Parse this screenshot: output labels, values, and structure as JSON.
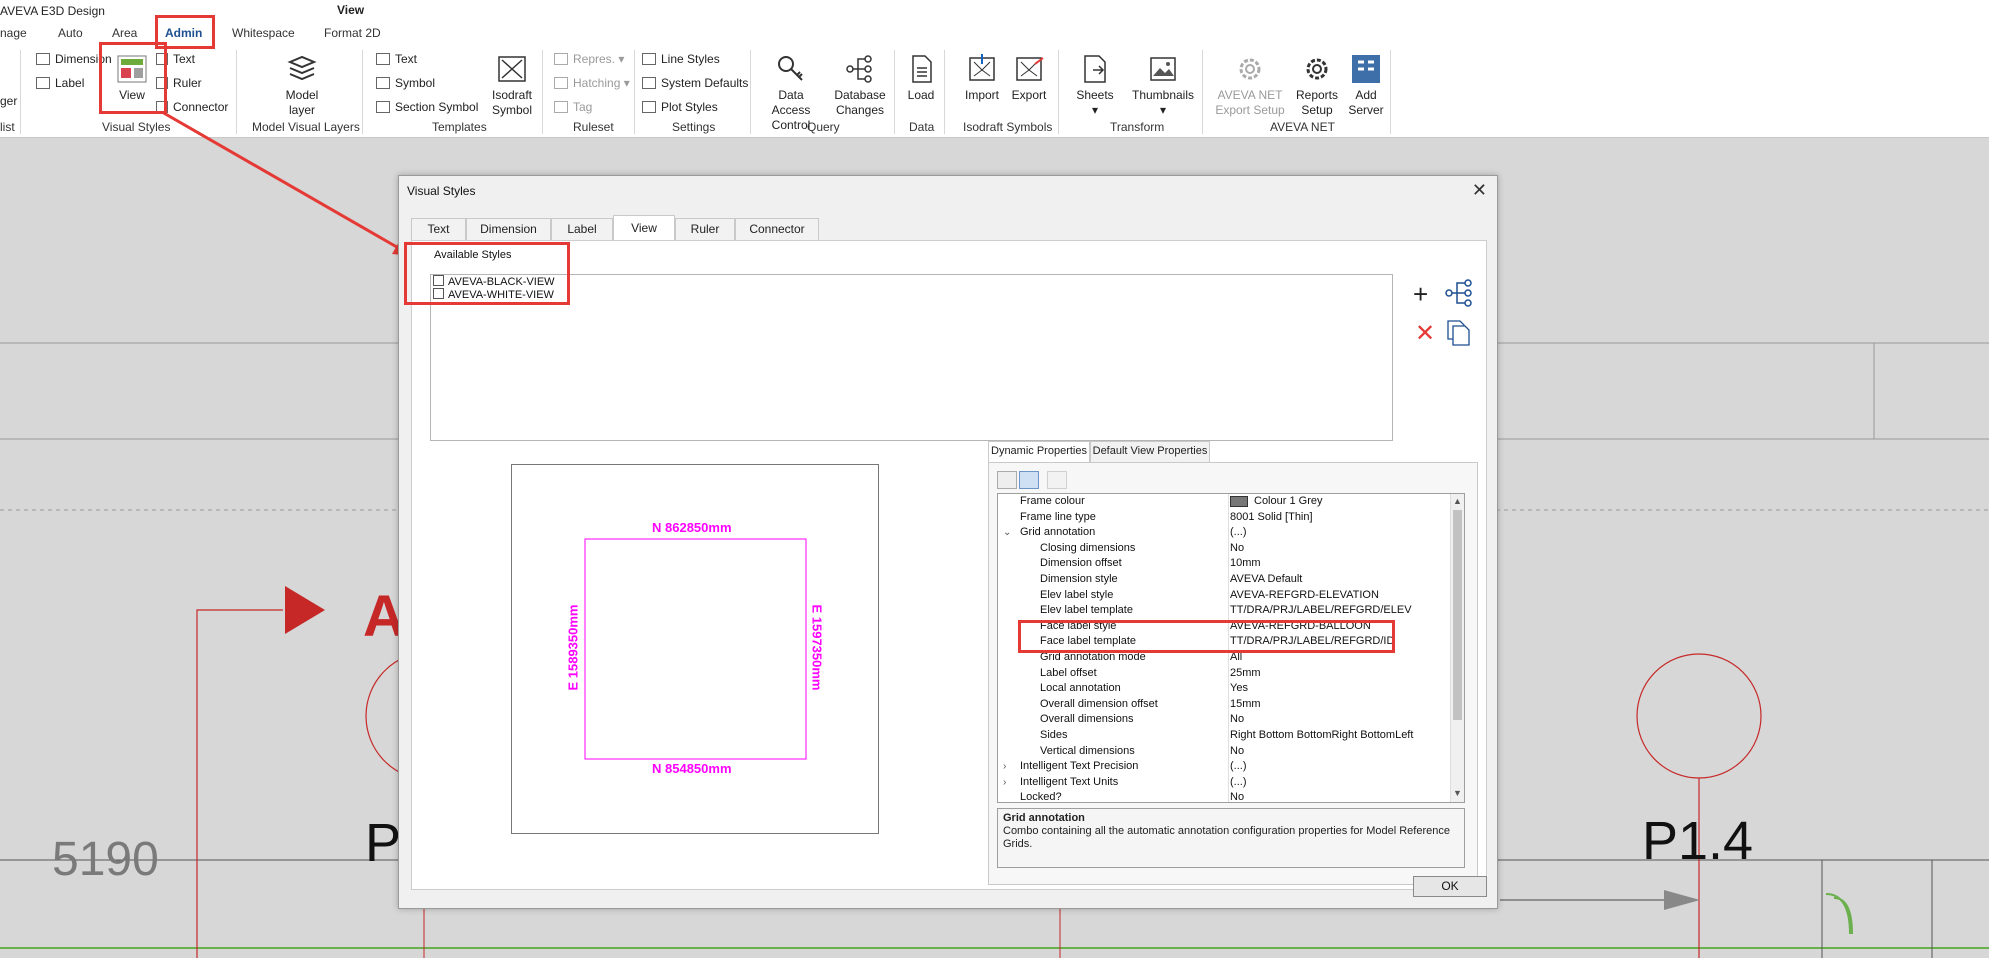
{
  "app": {
    "title": "AVEVA E3D Design",
    "document_title": "View"
  },
  "menu": {
    "tabs": [
      "nage",
      "Auto",
      "Area",
      "Admin",
      "Whitespace",
      "Format 2D"
    ],
    "active": "Admin"
  },
  "ribbon": {
    "groups": [
      {
        "label": "list",
        "items": [
          "ger"
        ]
      },
      {
        "label": "Visual Styles",
        "items": [
          "Dimension",
          "Label",
          "View",
          "Text",
          "Ruler",
          "Connector"
        ]
      },
      {
        "label": "Model Visual Layers",
        "items": [
          "Model",
          "layer"
        ]
      },
      {
        "label": "Templates",
        "items": [
          "Text",
          "Symbol",
          "Section Symbol",
          "Isodraft",
          "Symbol"
        ]
      },
      {
        "label": "Ruleset",
        "items": [
          "Repres.",
          "Hatching",
          "Tag"
        ]
      },
      {
        "label": "Settings",
        "items": [
          "Line Styles",
          "System Defaults",
          "Plot Styles"
        ]
      },
      {
        "label": "Query",
        "items": [
          "Data Access",
          "Control",
          "Database",
          "Changes"
        ]
      },
      {
        "label": "Data",
        "items": [
          "Load"
        ]
      },
      {
        "label": "Isodraft Symbols",
        "items": [
          "Import",
          "Export"
        ]
      },
      {
        "label": "Transform",
        "items": [
          "Sheets",
          "Thumbnails"
        ]
      },
      {
        "label": "AVEVA NET",
        "items": [
          "AVEVA NET",
          "Export Setup",
          "Reports",
          "Setup",
          "Add",
          "Server"
        ]
      }
    ]
  },
  "background": {
    "labels": [
      "5190",
      "P1.4",
      "A",
      "P"
    ]
  },
  "dialog": {
    "title": "Visual Styles",
    "tabs": [
      "Text",
      "Dimension",
      "Label",
      "View",
      "Ruler",
      "Connector"
    ],
    "active_tab": "View",
    "available_styles_label": "Available Styles",
    "styles": [
      "AVEVA-BLACK-VIEW",
      "AVEVA-WHITE-VIEW"
    ],
    "preview": {
      "top": "N 862850mm",
      "bottom": "N 854850mm",
      "left": "E 1589350mm",
      "right": "E 1597350mm"
    },
    "property_tabs": [
      "Dynamic Properties",
      "Default View Properties"
    ],
    "properties": [
      {
        "name": "Frame colour",
        "value": "Colour 1 Grey",
        "indent": 0
      },
      {
        "name": "Frame line type",
        "value": "8001 Solid [Thin]",
        "indent": 0
      },
      {
        "name": "Grid annotation",
        "value": "(...)",
        "indent": 0,
        "expander": "expanded"
      },
      {
        "name": "Closing dimensions",
        "value": "No",
        "indent": 1
      },
      {
        "name": "Dimension offset",
        "value": "10mm",
        "indent": 1
      },
      {
        "name": "Dimension style",
        "value": "AVEVA Default",
        "indent": 1
      },
      {
        "name": "Elev label style",
        "value": "AVEVA-REFGRD-ELEVATION",
        "indent": 1
      },
      {
        "name": "Elev label template",
        "value": "TT/DRA/PRJ/LABEL/REFGRD/ELEV",
        "indent": 1
      },
      {
        "name": "Face label style",
        "value": "AVEVA-REFGRD-BALLOON",
        "indent": 1
      },
      {
        "name": "Face label template",
        "value": "TT/DRA/PRJ/LABEL/REFGRD/ID",
        "indent": 1
      },
      {
        "name": "Grid annotation mode",
        "value": "All",
        "indent": 1
      },
      {
        "name": "Label offset",
        "value": "25mm",
        "indent": 1
      },
      {
        "name": "Local annotation",
        "value": "Yes",
        "indent": 1
      },
      {
        "name": "Overall dimension offset",
        "value": "15mm",
        "indent": 1
      },
      {
        "name": "Overall dimensions",
        "value": "No",
        "indent": 1
      },
      {
        "name": "Sides",
        "value": "Right Bottom BottomRight BottomLeft",
        "indent": 1
      },
      {
        "name": "Vertical dimensions",
        "value": "No",
        "indent": 1
      },
      {
        "name": "Intelligent Text Precision",
        "value": "(...)",
        "indent": 0,
        "expander": "collapsed"
      },
      {
        "name": "Intelligent Text Units",
        "value": "(...)",
        "indent": 0,
        "expander": "collapsed"
      },
      {
        "name": "Locked?",
        "value": "No",
        "indent": 0
      }
    ],
    "description": {
      "title": "Grid annotation",
      "text": "Combo containing all the automatic annotation configuration properties for Model Reference Grids."
    },
    "ok_label": "OK"
  },
  "colors": {
    "highlight": "#e53935",
    "preview_magenta": "#ff00ff",
    "background_red": "#c62828",
    "active_tab": "#1d4f91"
  }
}
